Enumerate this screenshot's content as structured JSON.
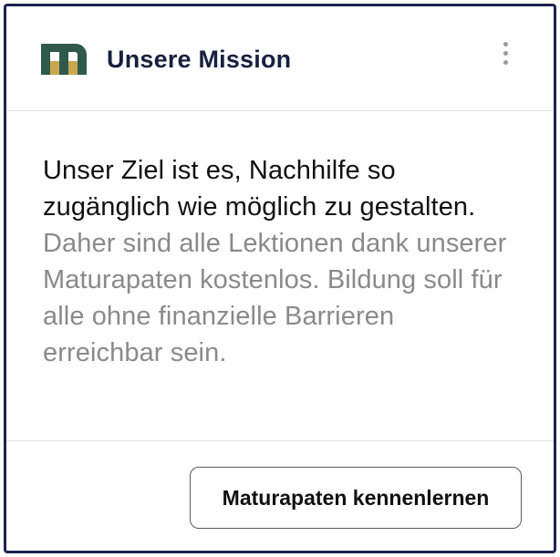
{
  "header": {
    "title": "Unsere Mission",
    "logo_icon": "brand-m-logo",
    "menu_icon": "more-vertical-icon"
  },
  "content": {
    "lead": "Unser Ziel ist es, Nachhilfe so zugänglich wie möglich zu gestalten.",
    "rest": "Daher sind alle Lektionen dank unserer Maturapaten kostenlos. Bildung soll für alle ohne finanzielle Barrieren erreichbar sein."
  },
  "footer": {
    "cta_label": "Maturapaten kennenlernen"
  },
  "colors": {
    "border": "#1b2550",
    "logo_green": "#2f5a4b",
    "logo_gold": "#c9a74e",
    "title": "#17213f",
    "muted_text": "#8a8a8a"
  }
}
